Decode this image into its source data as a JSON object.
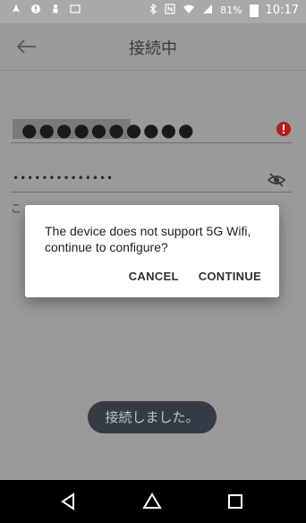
{
  "status_bar": {
    "battery_percent": "81%",
    "time": "10:17"
  },
  "appbar": {
    "title": "接続中"
  },
  "form": {
    "ssid_masked": "●●●●●●●●●●",
    "password_masked": "••••••••••••••",
    "info_text": "こ"
  },
  "dialog": {
    "message": "The device does not support 5G Wifi, continue to configure?",
    "cancel_label": "CANCEL",
    "continue_label": "CONTINUE"
  },
  "toast": {
    "text": "接続しました。"
  },
  "colors": {
    "status_bar": "#a9a9a9",
    "dim_overlay": "#9a9a9a",
    "error_red": "#b71c1c",
    "toast_bg": "#2f3640",
    "dialog_button_text": "#263238"
  }
}
